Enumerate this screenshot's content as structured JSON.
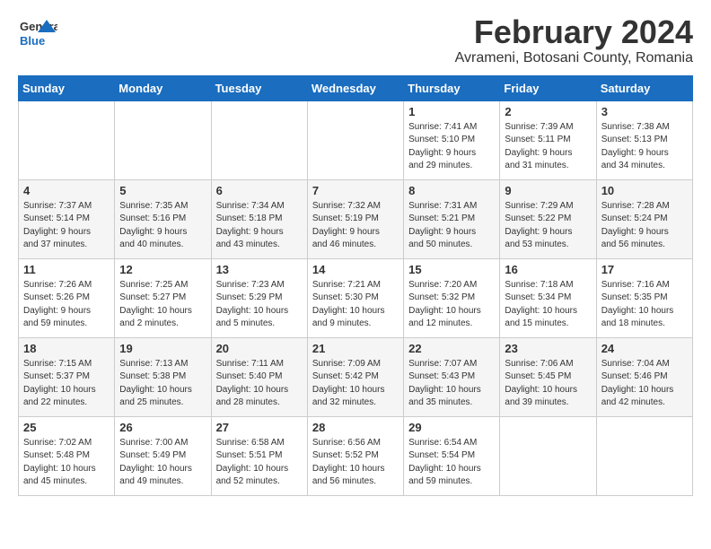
{
  "app": {
    "logo_general": "General",
    "logo_blue": "Blue",
    "month": "February 2024",
    "location": "Avrameni, Botosani County, Romania"
  },
  "calendar": {
    "headers": [
      "Sunday",
      "Monday",
      "Tuesday",
      "Wednesday",
      "Thursday",
      "Friday",
      "Saturday"
    ],
    "rows": [
      [
        {
          "day": "",
          "info": ""
        },
        {
          "day": "",
          "info": ""
        },
        {
          "day": "",
          "info": ""
        },
        {
          "day": "",
          "info": ""
        },
        {
          "day": "1",
          "info": "Sunrise: 7:41 AM\nSunset: 5:10 PM\nDaylight: 9 hours\nand 29 minutes."
        },
        {
          "day": "2",
          "info": "Sunrise: 7:39 AM\nSunset: 5:11 PM\nDaylight: 9 hours\nand 31 minutes."
        },
        {
          "day": "3",
          "info": "Sunrise: 7:38 AM\nSunset: 5:13 PM\nDaylight: 9 hours\nand 34 minutes."
        }
      ],
      [
        {
          "day": "4",
          "info": "Sunrise: 7:37 AM\nSunset: 5:14 PM\nDaylight: 9 hours\nand 37 minutes."
        },
        {
          "day": "5",
          "info": "Sunrise: 7:35 AM\nSunset: 5:16 PM\nDaylight: 9 hours\nand 40 minutes."
        },
        {
          "day": "6",
          "info": "Sunrise: 7:34 AM\nSunset: 5:18 PM\nDaylight: 9 hours\nand 43 minutes."
        },
        {
          "day": "7",
          "info": "Sunrise: 7:32 AM\nSunset: 5:19 PM\nDaylight: 9 hours\nand 46 minutes."
        },
        {
          "day": "8",
          "info": "Sunrise: 7:31 AM\nSunset: 5:21 PM\nDaylight: 9 hours\nand 50 minutes."
        },
        {
          "day": "9",
          "info": "Sunrise: 7:29 AM\nSunset: 5:22 PM\nDaylight: 9 hours\nand 53 minutes."
        },
        {
          "day": "10",
          "info": "Sunrise: 7:28 AM\nSunset: 5:24 PM\nDaylight: 9 hours\nand 56 minutes."
        }
      ],
      [
        {
          "day": "11",
          "info": "Sunrise: 7:26 AM\nSunset: 5:26 PM\nDaylight: 9 hours\nand 59 minutes."
        },
        {
          "day": "12",
          "info": "Sunrise: 7:25 AM\nSunset: 5:27 PM\nDaylight: 10 hours\nand 2 minutes."
        },
        {
          "day": "13",
          "info": "Sunrise: 7:23 AM\nSunset: 5:29 PM\nDaylight: 10 hours\nand 5 minutes."
        },
        {
          "day": "14",
          "info": "Sunrise: 7:21 AM\nSunset: 5:30 PM\nDaylight: 10 hours\nand 9 minutes."
        },
        {
          "day": "15",
          "info": "Sunrise: 7:20 AM\nSunset: 5:32 PM\nDaylight: 10 hours\nand 12 minutes."
        },
        {
          "day": "16",
          "info": "Sunrise: 7:18 AM\nSunset: 5:34 PM\nDaylight: 10 hours\nand 15 minutes."
        },
        {
          "day": "17",
          "info": "Sunrise: 7:16 AM\nSunset: 5:35 PM\nDaylight: 10 hours\nand 18 minutes."
        }
      ],
      [
        {
          "day": "18",
          "info": "Sunrise: 7:15 AM\nSunset: 5:37 PM\nDaylight: 10 hours\nand 22 minutes."
        },
        {
          "day": "19",
          "info": "Sunrise: 7:13 AM\nSunset: 5:38 PM\nDaylight: 10 hours\nand 25 minutes."
        },
        {
          "day": "20",
          "info": "Sunrise: 7:11 AM\nSunset: 5:40 PM\nDaylight: 10 hours\nand 28 minutes."
        },
        {
          "day": "21",
          "info": "Sunrise: 7:09 AM\nSunset: 5:42 PM\nDaylight: 10 hours\nand 32 minutes."
        },
        {
          "day": "22",
          "info": "Sunrise: 7:07 AM\nSunset: 5:43 PM\nDaylight: 10 hours\nand 35 minutes."
        },
        {
          "day": "23",
          "info": "Sunrise: 7:06 AM\nSunset: 5:45 PM\nDaylight: 10 hours\nand 39 minutes."
        },
        {
          "day": "24",
          "info": "Sunrise: 7:04 AM\nSunset: 5:46 PM\nDaylight: 10 hours\nand 42 minutes."
        }
      ],
      [
        {
          "day": "25",
          "info": "Sunrise: 7:02 AM\nSunset: 5:48 PM\nDaylight: 10 hours\nand 45 minutes."
        },
        {
          "day": "26",
          "info": "Sunrise: 7:00 AM\nSunset: 5:49 PM\nDaylight: 10 hours\nand 49 minutes."
        },
        {
          "day": "27",
          "info": "Sunrise: 6:58 AM\nSunset: 5:51 PM\nDaylight: 10 hours\nand 52 minutes."
        },
        {
          "day": "28",
          "info": "Sunrise: 6:56 AM\nSunset: 5:52 PM\nDaylight: 10 hours\nand 56 minutes."
        },
        {
          "day": "29",
          "info": "Sunrise: 6:54 AM\nSunset: 5:54 PM\nDaylight: 10 hours\nand 59 minutes."
        },
        {
          "day": "",
          "info": ""
        },
        {
          "day": "",
          "info": ""
        }
      ]
    ]
  }
}
